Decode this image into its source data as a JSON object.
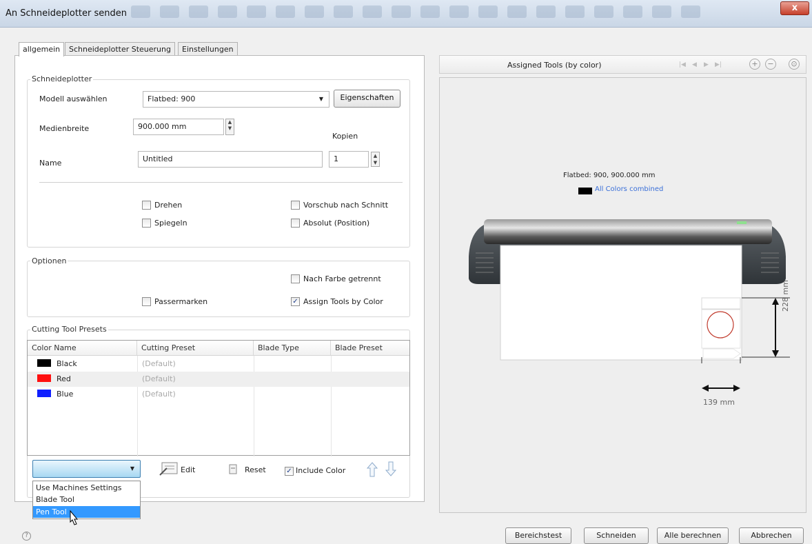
{
  "window": {
    "title": "An Schneideplotter senden",
    "close_label": "x"
  },
  "tabs": [
    {
      "label": "allgemein"
    },
    {
      "label": "Schneideplotter Steuerung"
    },
    {
      "label": "Einstellungen"
    }
  ],
  "plotter": {
    "group_label": "Schneideplotter",
    "model_label": "Modell auswählen",
    "model_value": "Flatbed: 900",
    "properties_button": "Eigenschaften",
    "media_width_label": "Medienbreite",
    "media_width_value": "900.000 mm",
    "copies_label": "Kopien",
    "copies_value": "1",
    "name_label": "Name",
    "name_value": "Untitled",
    "rotate_label": "Drehen",
    "mirror_label": "Spiegeln",
    "feed_after_cut_label": "Vorschub nach Schnitt",
    "absolute_position_label": "Absolut (Position)"
  },
  "options": {
    "group_label": "Optionen",
    "separate_by_color_label": "Nach Farbe getrennt",
    "registration_marks_label": "Passermarken",
    "assign_tools_label": "Assign Tools by Color",
    "assign_tools_checked": true
  },
  "presets": {
    "group_label": "Cutting Tool Presets",
    "columns": [
      "Color Name",
      "Cutting Preset",
      "Blade Type",
      "Blade Preset"
    ],
    "rows": [
      {
        "color_name": "Black",
        "swatch": "#000000",
        "cutting_preset": "(Default)"
      },
      {
        "color_name": "Red",
        "swatch": "#ff1010",
        "cutting_preset": "(Default)"
      },
      {
        "color_name": "Blue",
        "swatch": "#1020ff",
        "cutting_preset": "(Default)"
      }
    ],
    "edit_label": "Edit",
    "reset_label": "Reset",
    "include_color_label": "Include Color",
    "include_color_checked": true,
    "dropdown_options": [
      "Use Machines Settings",
      "Blade Tool",
      "Pen Tool"
    ],
    "dropdown_highlighted": "Pen Tool"
  },
  "preview": {
    "header_title": "Assigned Tools (by color)",
    "plotter_caption": "Flatbed: 900,  900.000 mm",
    "legend_label": "All Colors combined",
    "height_dimension": "228 mm",
    "width_dimension": "139 mm",
    "nav_first": "|◀",
    "nav_prev": "◀",
    "nav_next": "▶",
    "nav_last": "▶|",
    "zoom_in": "+",
    "zoom_out": "−",
    "zoom_fit": "⊙"
  },
  "footer": {
    "help_icon": "?",
    "test_button": "Bereichstest",
    "cut_button": "Schneiden",
    "calc_all_button": "Alle berechnen",
    "cancel_button": "Abbrechen"
  },
  "colors": {
    "accent": "#3399ff",
    "legend_text": "#3a6fd8"
  }
}
